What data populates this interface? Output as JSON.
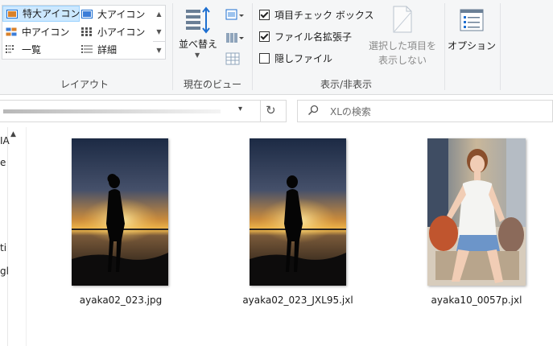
{
  "ribbon": {
    "layout": {
      "items": [
        {
          "label": "特大アイコン",
          "icon": "extra-large-icons-icon",
          "selected": true
        },
        {
          "label": "大アイコン",
          "icon": "large-icons-icon",
          "selected": false
        },
        {
          "label": "中アイコン",
          "icon": "medium-icons-icon",
          "selected": false
        },
        {
          "label": "小アイコン",
          "icon": "small-icons-icon",
          "selected": false
        },
        {
          "label": "一覧",
          "icon": "list-icon",
          "selected": false
        },
        {
          "label": "詳細",
          "icon": "details-icon",
          "selected": false
        }
      ],
      "group_label": "レイアウト"
    },
    "current_view": {
      "sort_label": "並べ替え",
      "group_label": "現在のビュー"
    },
    "show_hide": {
      "checkboxes": [
        {
          "label": "項目チェック ボックス",
          "checked": true
        },
        {
          "label": "ファイル名拡張子",
          "checked": true
        },
        {
          "label": "隠しファイル",
          "checked": false
        }
      ],
      "hide_selected_line1": "選択した項目を",
      "hide_selected_line2": "表示しない",
      "group_label": "表示/非表示"
    },
    "options_label": "オプション"
  },
  "search": {
    "placeholder": "XLの検索"
  },
  "nav": {
    "fragments": [
      "IA",
      "e",
      "ti",
      "gl"
    ]
  },
  "files": [
    {
      "name": "ayaka02_023.jpg",
      "thumb": "sunset-silhouette"
    },
    {
      "name": "ayaka02_023_JXL95.jxl",
      "thumb": "sunset-silhouette"
    },
    {
      "name": "ayaka10_0057p.jxl",
      "thumb": "portrait-photo"
    }
  ],
  "colors": {
    "selection": "#cce8ff",
    "selection_border": "#99d1ff",
    "accent_blue": "#1e6fd0"
  }
}
